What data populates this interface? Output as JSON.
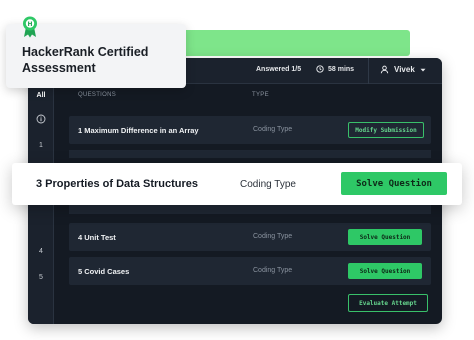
{
  "certificate": {
    "title": "HackerRank Certified Assessment"
  },
  "topbar": {
    "answered": "Answered 1/5",
    "timer": "58 mins",
    "user": "Vivek"
  },
  "sidebar": {
    "all_label": "All",
    "items": [
      "1",
      "4",
      "5"
    ]
  },
  "table": {
    "col_questions": "QUESTIONS",
    "col_type": "TYPE",
    "rows": [
      {
        "question": "1  Maximum Difference in an Array",
        "type": "Coding Type",
        "action": "Modify Submission"
      },
      {
        "question": "3  Properties of Data Structures",
        "type": "Coding Type",
        "action": "Solve Question"
      },
      {
        "question": "4  Unit Test",
        "type": "Coding Type",
        "action": "Solve Question"
      },
      {
        "question": "5  Covid Cases",
        "type": "Coding Type",
        "action": "Solve Question"
      }
    ]
  },
  "evaluate_label": "Evaluate Attempt",
  "colors": {
    "panel_bg": "#141a23",
    "accent_green": "#2ec866",
    "green_bar": "#7ee58a"
  }
}
